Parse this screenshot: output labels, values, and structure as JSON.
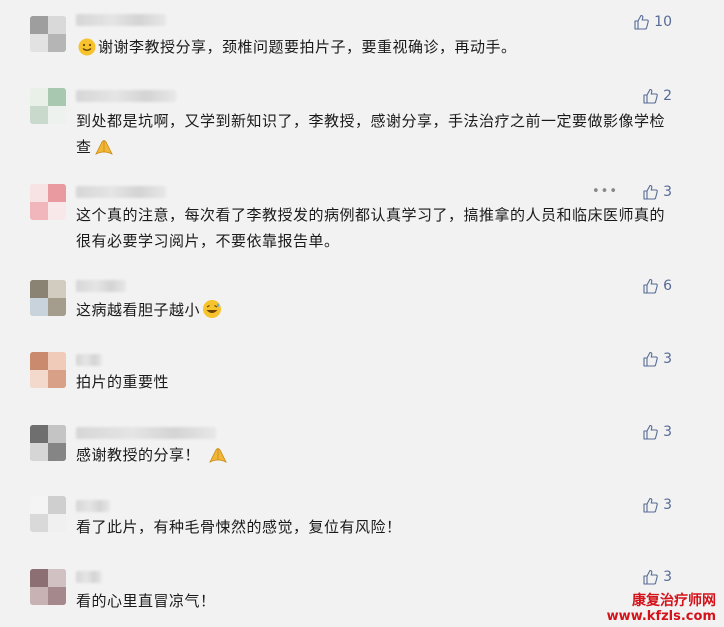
{
  "comments": [
    {
      "text": "谢谢李教授分享，颈椎问题要拍片子，要重视确诊，再动手。",
      "likes": "10",
      "lead_emoji": "smile-emoji",
      "trail_emoji": ""
    },
    {
      "text": "到处都是坑啊，又学到新知识了，李教授，感谢分享，手法治疗之前一定要做影像学检查",
      "likes": "2",
      "lead_emoji": "",
      "trail_emoji": "pray-emoji"
    },
    {
      "text": "这个真的注意，每次看了李教授发的病例都认真学习了，搞推拿的人员和临床医师真的很有必要学习阅片，不要依靠报告单。",
      "likes": "3",
      "lead_emoji": "",
      "trail_emoji": "",
      "more": "•••"
    },
    {
      "text": "这病越看胆子越小",
      "likes": "6",
      "lead_emoji": "",
      "trail_emoji": "sweat-laugh-emoji"
    },
    {
      "text": "拍片的重要性",
      "likes": "3",
      "lead_emoji": "",
      "trail_emoji": ""
    },
    {
      "text": "感谢教授的分享！",
      "likes": "3",
      "lead_emoji": "",
      "trail_emoji": "pray-emoji"
    },
    {
      "text": "看了此片，有种毛骨悚然的感觉，复位有风险！",
      "likes": "3",
      "lead_emoji": "",
      "trail_emoji": ""
    },
    {
      "text": "看的心里直冒凉气！",
      "likes": "3",
      "lead_emoji": "",
      "trail_emoji": ""
    }
  ],
  "icons": {
    "like": "thumbs-up-icon"
  },
  "colors": {
    "like": "#576b95",
    "watermark": "#d4121a",
    "background": "#f2f2f2"
  },
  "watermark": {
    "line1": "康复治疗师网",
    "line2": "www.kfzls.com"
  }
}
